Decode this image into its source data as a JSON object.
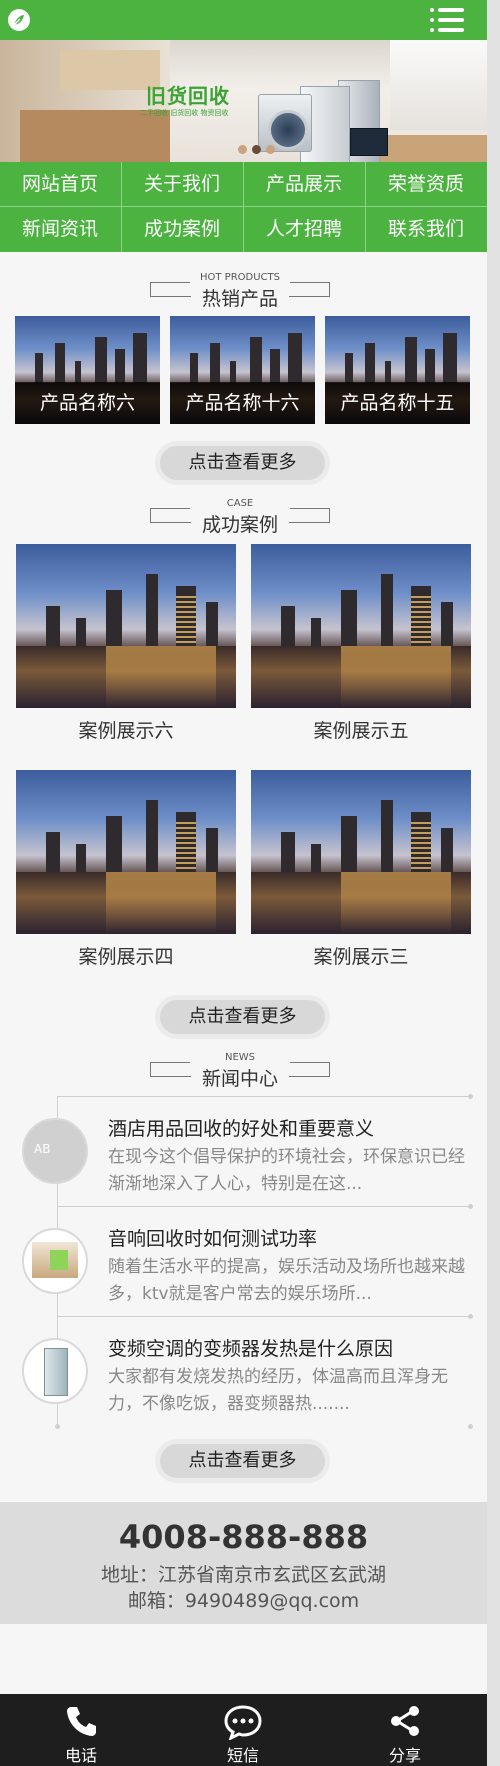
{
  "banner": {
    "title": "旧货回收",
    "subtitle": "二手回收  旧货回收  物资回收"
  },
  "nav": {
    "items": [
      {
        "label": "网站首页"
      },
      {
        "label": "关于我们"
      },
      {
        "label": "产品展示"
      },
      {
        "label": "荣誉资质"
      },
      {
        "label": "新闻资讯"
      },
      {
        "label": "成功案例"
      },
      {
        "label": "人才招聘"
      },
      {
        "label": "联系我们"
      }
    ]
  },
  "hot_products": {
    "title_en": "HOT PRODUCTS",
    "title_cn": "热销产品",
    "items": [
      {
        "label": "产品名称六"
      },
      {
        "label": "产品名称十六"
      },
      {
        "label": "产品名称十五"
      }
    ],
    "more": "点击查看更多"
  },
  "cases": {
    "title_en": "CASE",
    "title_cn": "成功案例",
    "items": [
      {
        "label": "案例展示六"
      },
      {
        "label": "案例展示五"
      },
      {
        "label": "案例展示四"
      },
      {
        "label": "案例展示三"
      }
    ],
    "more": "点击查看更多"
  },
  "news": {
    "title_en": "NEWS",
    "title_cn": "新闻中心",
    "items": [
      {
        "title": "酒店用品回收的好处和重要意义",
        "desc": "在现今这个倡导保护的环境社会，环保意识已经渐渐地深入了人心，特别是在这..."
      },
      {
        "title": "音响回收时如何测试功率",
        "desc": "随着生活水平的提高，娱乐活动及场所也越来越多，ktv就是客户常去的娱乐场所..."
      },
      {
        "title": "变频空调的变频器发热是什么原因",
        "desc": "大家都有发烧发热的经历，体温高而且浑身无力，不像吃饭，器变频器热......."
      }
    ],
    "more": "点击查看更多"
  },
  "contact": {
    "phone": "4008-888-888",
    "address": "地址：江苏省南京市玄武区玄武湖",
    "email": "邮箱：9490489@qq.com"
  },
  "bottombar": {
    "call": "电话",
    "sms": "短信",
    "share": "分享"
  },
  "colors": {
    "brand": "#4cb340",
    "bottombar": "#1e1e1e"
  }
}
